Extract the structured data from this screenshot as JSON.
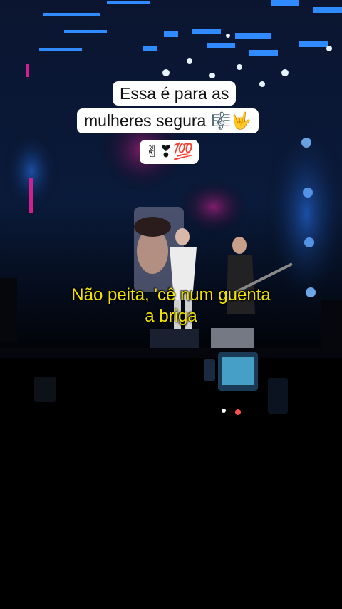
{
  "overlay": {
    "caption_line1": "Essa é para as",
    "caption_line2_text": "mulheres segura",
    "caption_line2_emojis": "🎼🤟",
    "caption_line3_emojis": "✌❣💯"
  },
  "subtitles": {
    "line1": "Não peita, 'cê num guenta",
    "line2": "a briga"
  },
  "colors": {
    "subtitle": "#f2e400",
    "caption_bg": "#ffffff",
    "stage_blue": "#1e6bff",
    "stage_magenta": "#c0208c"
  }
}
